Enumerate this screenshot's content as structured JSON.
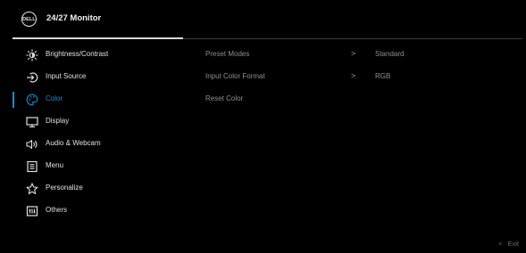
{
  "header": {
    "logo_text": "DELL",
    "title": "24/27 Monitor"
  },
  "menu": {
    "items": [
      {
        "label": "Brightness/Contrast",
        "icon": "brightness-icon"
      },
      {
        "label": "Input Source",
        "icon": "input-source-icon"
      },
      {
        "label": "Color",
        "icon": "color-palette-icon",
        "active": true
      },
      {
        "label": "Display",
        "icon": "display-icon"
      },
      {
        "label": "Audio & Webcam",
        "icon": "audio-speaker-icon"
      },
      {
        "label": "Menu",
        "icon": "menu-list-icon"
      },
      {
        "label": "Personalize",
        "icon": "star-icon"
      },
      {
        "label": "Others",
        "icon": "others-icon"
      }
    ]
  },
  "submenu": {
    "rows": [
      {
        "label": "Preset Modes",
        "chevron": ">",
        "value": "Standard"
      },
      {
        "label": "Input Color Format",
        "chevron": ">",
        "value": "RGB"
      },
      {
        "label": "Reset Color"
      }
    ]
  },
  "footer": {
    "exit_chevron": "<",
    "exit_label": "Exit"
  },
  "colors": {
    "accent": "#1a8cd8",
    "background": "#000000",
    "text": "#e0e0e0",
    "muted": "#8e8e8e"
  }
}
